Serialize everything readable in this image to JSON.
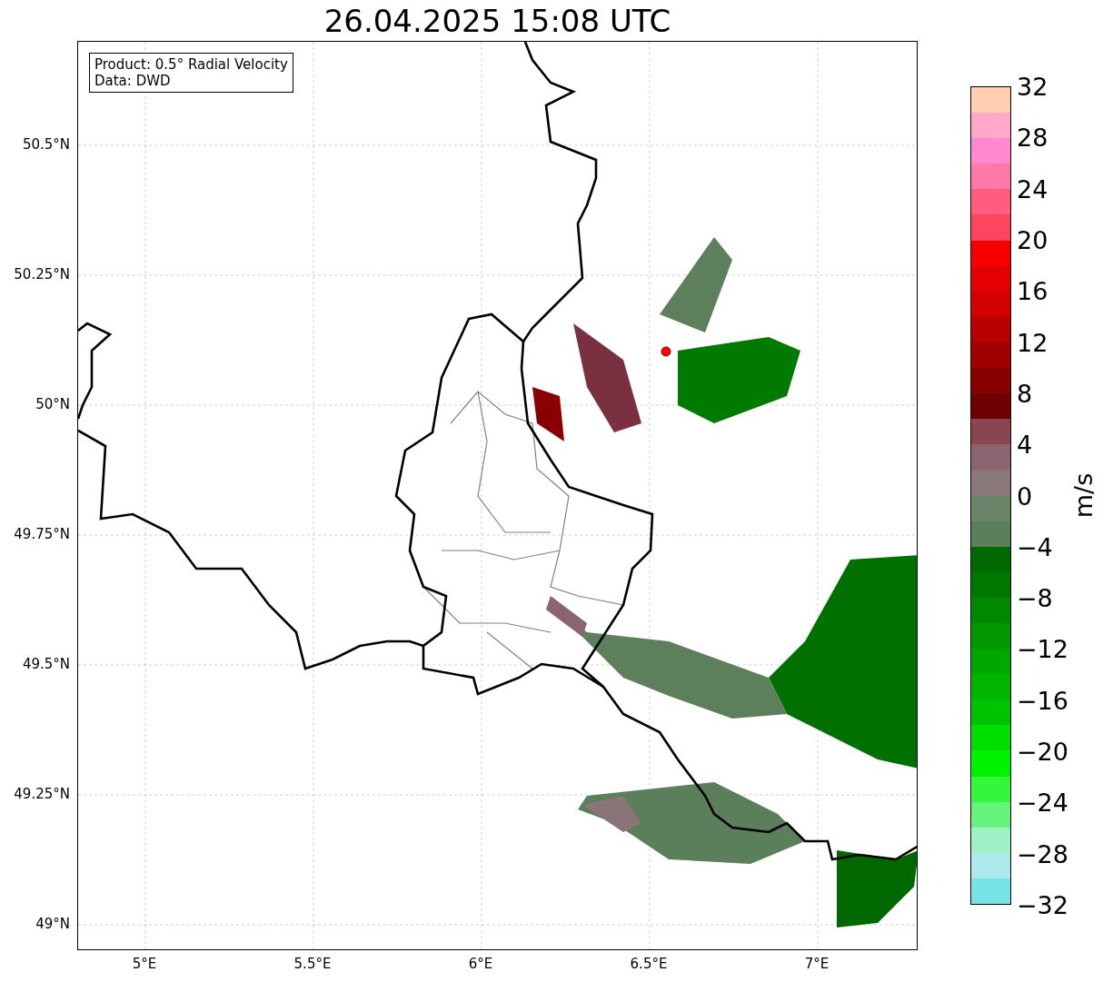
{
  "title": "26.04.2025 15:08 UTC",
  "info_box": {
    "lines": [
      "Product: 0.5° Radial Velocity",
      "Data: DWD"
    ]
  },
  "y_ticks": [
    "50.5°N",
    "50.25°N",
    "50°N",
    "49.75°N",
    "49.5°N",
    "49.25°N",
    "49°N"
  ],
  "x_ticks": [
    "5°E",
    "5.5°E",
    "6°E",
    "6.5°E",
    "7°E"
  ],
  "colorbar": {
    "label": "m/s",
    "ticks": [
      "32",
      "28",
      "24",
      "20",
      "16",
      "12",
      "8",
      "4",
      "0",
      "−4",
      "−8",
      "−12",
      "−16",
      "−20",
      "−24",
      "−28",
      "−32"
    ],
    "bands": [
      {
        "color": "#ffcfb0"
      },
      {
        "color": "#ffa8c8"
      },
      {
        "color": "#ff88d0"
      },
      {
        "color": "#ff78a8"
      },
      {
        "color": "#ff5c80"
      },
      {
        "color": "#ff4460"
      },
      {
        "color": "#f80000"
      },
      {
        "color": "#e40000"
      },
      {
        "color": "#d20000"
      },
      {
        "color": "#b80000"
      },
      {
        "color": "#9e0000"
      },
      {
        "color": "#880000"
      },
      {
        "color": "#700000"
      },
      {
        "color": "#8a4650"
      },
      {
        "color": "#8a6470"
      },
      {
        "color": "#8a7878"
      },
      {
        "color": "#6a8468"
      },
      {
        "color": "#5a7f5a"
      },
      {
        "color": "#006800"
      },
      {
        "color": "#007800"
      },
      {
        "color": "#008900"
      },
      {
        "color": "#009a00"
      },
      {
        "color": "#00a700"
      },
      {
        "color": "#00b400"
      },
      {
        "color": "#00c300"
      },
      {
        "color": "#00e000"
      },
      {
        "color": "#00f300"
      },
      {
        "color": "#33f73b"
      },
      {
        "color": "#66f47c"
      },
      {
        "color": "#9ef2c6"
      },
      {
        "color": "#aeeaed"
      },
      {
        "color": "#76e3e6"
      }
    ]
  }
}
